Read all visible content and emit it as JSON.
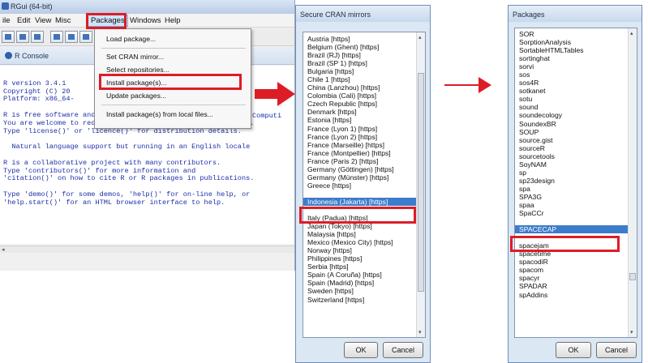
{
  "rgui": {
    "title": "RGui (64-bit)",
    "menus": {
      "file": "ile",
      "edit": "Edit",
      "view": "View",
      "misc": "Misc",
      "packages": "Packages",
      "windows": "Windows",
      "help": "Help"
    },
    "console_title": "R Console",
    "console_lines": [
      "",
      "R version 3.4.1",
      "Copyright (C) 20",
      "Platform: x86_64-",
      "",
      "R is free software and comes with ABSOLUTELY NO WARRANTY.",
      "You are welcome to redistribute it under certain conditions.",
      "Type 'license()' or 'licence()' for distribution details.",
      "",
      "  Natural language support but running in an English locale",
      "",
      "R is a collaborative project with many contributors.",
      "Type 'contributors()' for more information and",
      "'citation()' on how to cite R or R packages in publications.",
      "",
      "Type 'demo()' for some demos, 'help()' for on-line help, or",
      "'help.start()' for an HTML browser interface to help."
    ],
    "console_overflow_text": "Computi",
    "packages_menu": {
      "load": "Load package...",
      "set_cran": "Set CRAN mirror...",
      "select_repos": "Select repositories...",
      "install": "Install package(s)...",
      "update": "Update packages...",
      "install_local": "Install package(s) from local files..."
    }
  },
  "mirrors_dialog": {
    "title": "Secure CRAN mirrors",
    "items": [
      "Austria [https]",
      "Belgium (Ghent) [https]",
      "Brazil (RJ) [https]",
      "Brazil (SP 1) [https]",
      "Bulgaria [https]",
      "Chile 1 [https]",
      "China (Lanzhou) [https]",
      "Colombia (Cali) [https]",
      "Czech Republic [https]",
      "Denmark [https]",
      "Estonia [https]",
      "France (Lyon 1) [https]",
      "France (Lyon 2) [https]",
      "France (Marseille) [https]",
      "France (Montpellier) [https]",
      "France (Paris 2) [https]",
      "Germany (Göttingen) [https]",
      "Germany (Münster) [https]",
      "Greece [https]",
      "",
      "Indonesia (Jakarta) [https]",
      "",
      "Italy (Padua) [https]",
      "Japan (Tokyo) [https]",
      "Malaysia [https]",
      "Mexico (Mexico City) [https]",
      "Norway [https]",
      "Philippines [https]",
      "Serbia [https]",
      "Spain (A Coruña) [https]",
      "Spain (Madrid) [https]",
      "Sweden [https]",
      "Switzerland [https]"
    ],
    "selected_index": 20,
    "ok_label": "OK",
    "cancel_label": "Cancel"
  },
  "packages_dialog": {
    "title": "Packages",
    "items": [
      "SOR",
      "SorptionAnalysis",
      "SortableHTMLTables",
      "sortinghat",
      "sorvi",
      "sos",
      "sos4R",
      "sotkanet",
      "sotu",
      "sound",
      "soundecology",
      "SoundexBR",
      "SOUP",
      "source.gist",
      "sourceR",
      "sourcetools",
      "SoyNAM",
      "sp",
      "sp23design",
      "spa",
      "SPA3G",
      "spaa",
      "SpaCCr",
      "",
      "SPACECAP",
      "",
      "spacejam",
      "spacetime",
      "spacodiR",
      "spacom",
      "spacyr",
      "SPADAR",
      "spAddins"
    ],
    "selected_index": 24,
    "ok_label": "OK",
    "cancel_label": "Cancel"
  },
  "colors": {
    "highlight_red": "#dc1d26",
    "selection_blue": "#3d7ccb",
    "console_text": "#1c2fa8"
  }
}
